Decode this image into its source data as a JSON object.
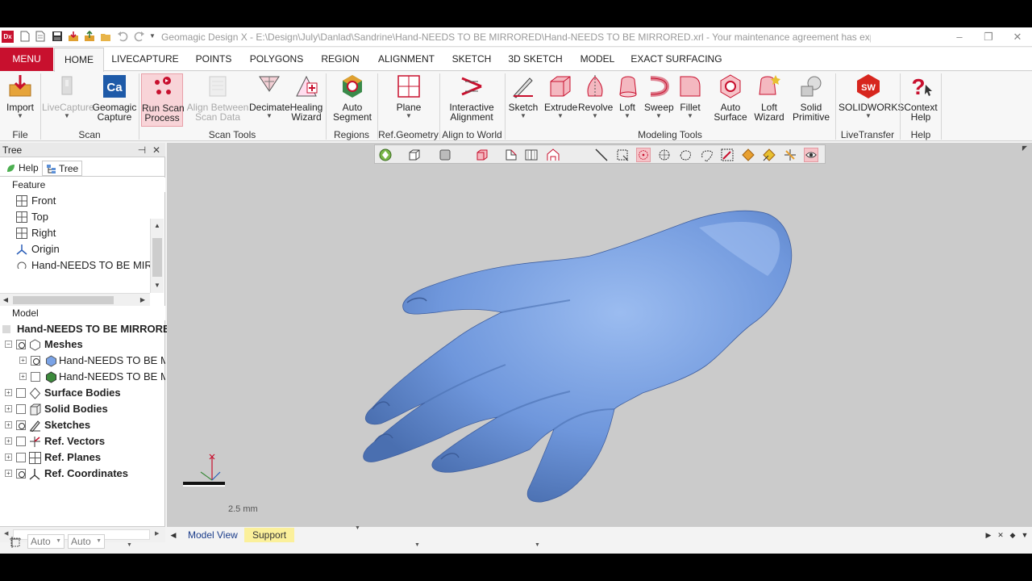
{
  "titlebar": {
    "app_logo": "Dx",
    "title": "Geomagic Design X - E:\\Design\\July\\Danlad\\Sandrine\\Hand-NEEDS TO BE MIRRORED\\Hand-NEEDS TO BE MIRRORED.xrl - Your maintenance agreement has expired.",
    "minimize": "–",
    "restore": "❐",
    "close": "✕"
  },
  "menu": {
    "menu_button": "MENU",
    "tabs": [
      "HOME",
      "LIVECAPTURE",
      "POINTS",
      "POLYGONS",
      "REGION",
      "ALIGNMENT",
      "SKETCH",
      "3D SKETCH",
      "MODEL",
      "EXACT SURFACING"
    ]
  },
  "ribbon": {
    "import": "Import",
    "livecapture": "LiveCapture",
    "geomagic_capture_1": "Geomagic",
    "geomagic_capture_2": "Capture",
    "run_scan_1": "Run Scan",
    "run_scan_2": "Process",
    "align_between_1": "Align Between",
    "align_between_2": "Scan Data",
    "decimate": "Decimate",
    "healing_1": "Healing",
    "healing_2": "Wizard",
    "auto_segment_1": "Auto",
    "auto_segment_2": "Segment",
    "plane": "Plane",
    "interactive_1": "Interactive",
    "interactive_2": "Alignment",
    "sketch": "Sketch",
    "extrude": "Extrude",
    "revolve": "Revolve",
    "loft": "Loft",
    "sweep": "Sweep",
    "fillet": "Fillet",
    "auto_surface_1": "Auto",
    "auto_surface_2": "Surface",
    "loft_wizard_1": "Loft",
    "loft_wizard_2": "Wizard",
    "solid_primitive_1": "Solid",
    "solid_primitive_2": "Primitive",
    "solidworks": "SOLIDWORKS",
    "context_help_1": "Context",
    "context_help_2": "Help",
    "groups": {
      "file": "File",
      "scan": "Scan",
      "scan_tools": "Scan Tools",
      "regions": "Regions",
      "ref_geometry": "Ref.Geometry",
      "align_to_world": "Align to World",
      "modeling_tools": "Modeling Tools",
      "livetransfer": "LiveTransfer",
      "help": "Help"
    },
    "icons": {
      "solidworks_badge": "SW",
      "capture_badge": "Ca"
    }
  },
  "tree_panel": {
    "title": "Tree",
    "pin": "⊣",
    "close": "✕",
    "subtabs": [
      "Help",
      "Tree"
    ],
    "feature_label": "Feature",
    "features": [
      "Front",
      "Top",
      "Right",
      "Origin",
      "Hand-NEEDS TO BE MIRR"
    ],
    "model_label": "Model",
    "model_root": "Hand-NEEDS TO BE MIRRORED",
    "model_items": [
      {
        "label": "Meshes"
      },
      {
        "label": "Hand-NEEDS TO BE MIR"
      },
      {
        "label": "Hand-NEEDS TO BE MIR"
      },
      {
        "label": "Surface Bodies"
      },
      {
        "label": "Solid Bodies"
      },
      {
        "label": "Sketches"
      },
      {
        "label": "Ref. Vectors"
      },
      {
        "label": "Ref. Planes"
      },
      {
        "label": "Ref. Coordinates"
      }
    ]
  },
  "viewport": {
    "scale_label": "2.5 mm",
    "mesh_color": "#7aa3e6",
    "background_color": "#cbcbcb"
  },
  "bottom_tabs": {
    "model_view": "Model View",
    "support": "Support"
  },
  "status": {
    "combo1": "Auto",
    "combo2": "Auto"
  },
  "colors": {
    "brand_red": "#c8102e",
    "selected_pink": "#f6c3c8",
    "support_tab": "#fbf09b"
  }
}
